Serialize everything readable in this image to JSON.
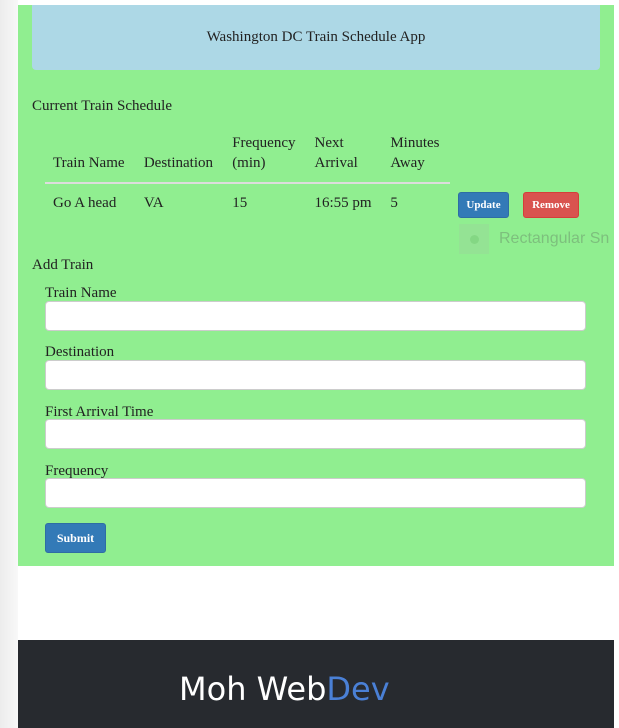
{
  "header": {
    "title": "Washington DC Train Schedule App"
  },
  "schedule": {
    "title": "Current Train Schedule",
    "columns": {
      "train_name": "Train Name",
      "destination": "Destination",
      "frequency_line1": "Frequency",
      "frequency_line2": "(min)",
      "next_line1": "Next",
      "next_line2": "Arrival",
      "minutes_line1": "Minutes",
      "minutes_line2": "Away"
    },
    "rows": [
      {
        "train_name": "Go A head",
        "destination": "VA",
        "frequency": "15",
        "next_arrival": "16:55 pm",
        "minutes_away": "5",
        "update_label": "Update",
        "remove_label": "Remove"
      }
    ]
  },
  "overlay": {
    "text": "Rectangular Sn"
  },
  "add_train": {
    "title": "Add Train",
    "fields": {
      "train_name": {
        "label": "Train Name",
        "value": ""
      },
      "destination": {
        "label": "Destination",
        "value": ""
      },
      "first_arrival": {
        "label": "First Arrival Time",
        "value": ""
      },
      "frequency": {
        "label": "Frequency",
        "value": ""
      }
    },
    "submit_label": "Submit"
  },
  "footer": {
    "brand_main": "Moh Web",
    "brand_accent": "Dev"
  },
  "colors": {
    "app_bg": "#90ee90",
    "header_bg": "#add8e6",
    "primary": "#337ab7",
    "danger": "#d9534f",
    "footer_bg": "#272a2f",
    "brand_accent": "#4a80d6"
  }
}
